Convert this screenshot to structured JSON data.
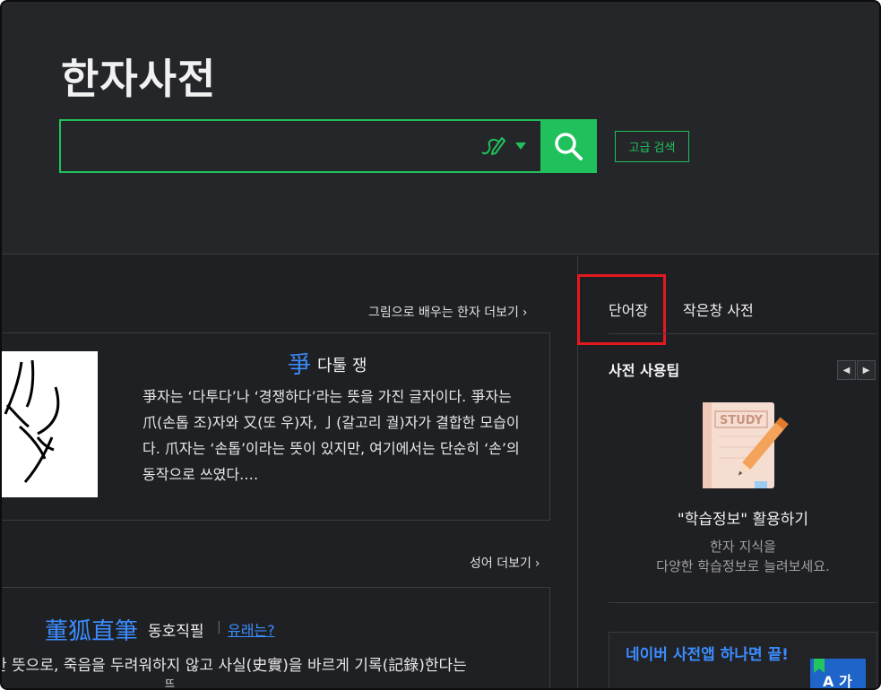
{
  "header": {
    "site_title": "한자사전",
    "search_placeholder": "",
    "advanced_search_label": "고급 검색"
  },
  "hanja_section": {
    "more_link": "그림으로 배우는 한자 더보기",
    "character": "爭",
    "meaning": "다툴 쟁",
    "description": "爭자는 ‘다투다’나 ‘경쟁하다’라는 뜻을 가진 글자이다. 爭자는 爪(손톱 조)자와 又(또 우)자, 亅(갈고리 궐)자가 결합한 모습이다. 爪자는 ‘손톱’이라는 뜻이 있지만, 여기에서는 단순히 ‘손’의 동작으로 쓰였다.…"
  },
  "idiom_section": {
    "more_link": "성어 더보기",
    "title": "董狐直筆",
    "reading": "동호직필",
    "separator": "|",
    "origin_link": "유래는?",
    "description": "한 뜻으로, 죽음을 두려워하지 않고 사실(史實)을 바르게 기록(記錄)한다는",
    "description_cont": "뜨"
  },
  "sidebar": {
    "tabs": [
      {
        "label": "단어장"
      },
      {
        "label": "작은창 사전"
      }
    ],
    "tips_title": "사전 사용팁",
    "nav_prev": "◀",
    "nav_next": "▶",
    "study_label": "STUDY",
    "study_title": "\"학습정보\" 활용하기",
    "study_sub_1": "한자 지식을",
    "study_sub_2": "다양한 학습정보로 늘려보세요.",
    "app_banner": "네이버 사전앱 하나면 끝!",
    "app_icon_label": "A 가"
  },
  "colors": {
    "accent": "#20c15c",
    "link_blue": "#3b8dff",
    "highlight_red": "#e3191f",
    "background": "#1f2023"
  }
}
